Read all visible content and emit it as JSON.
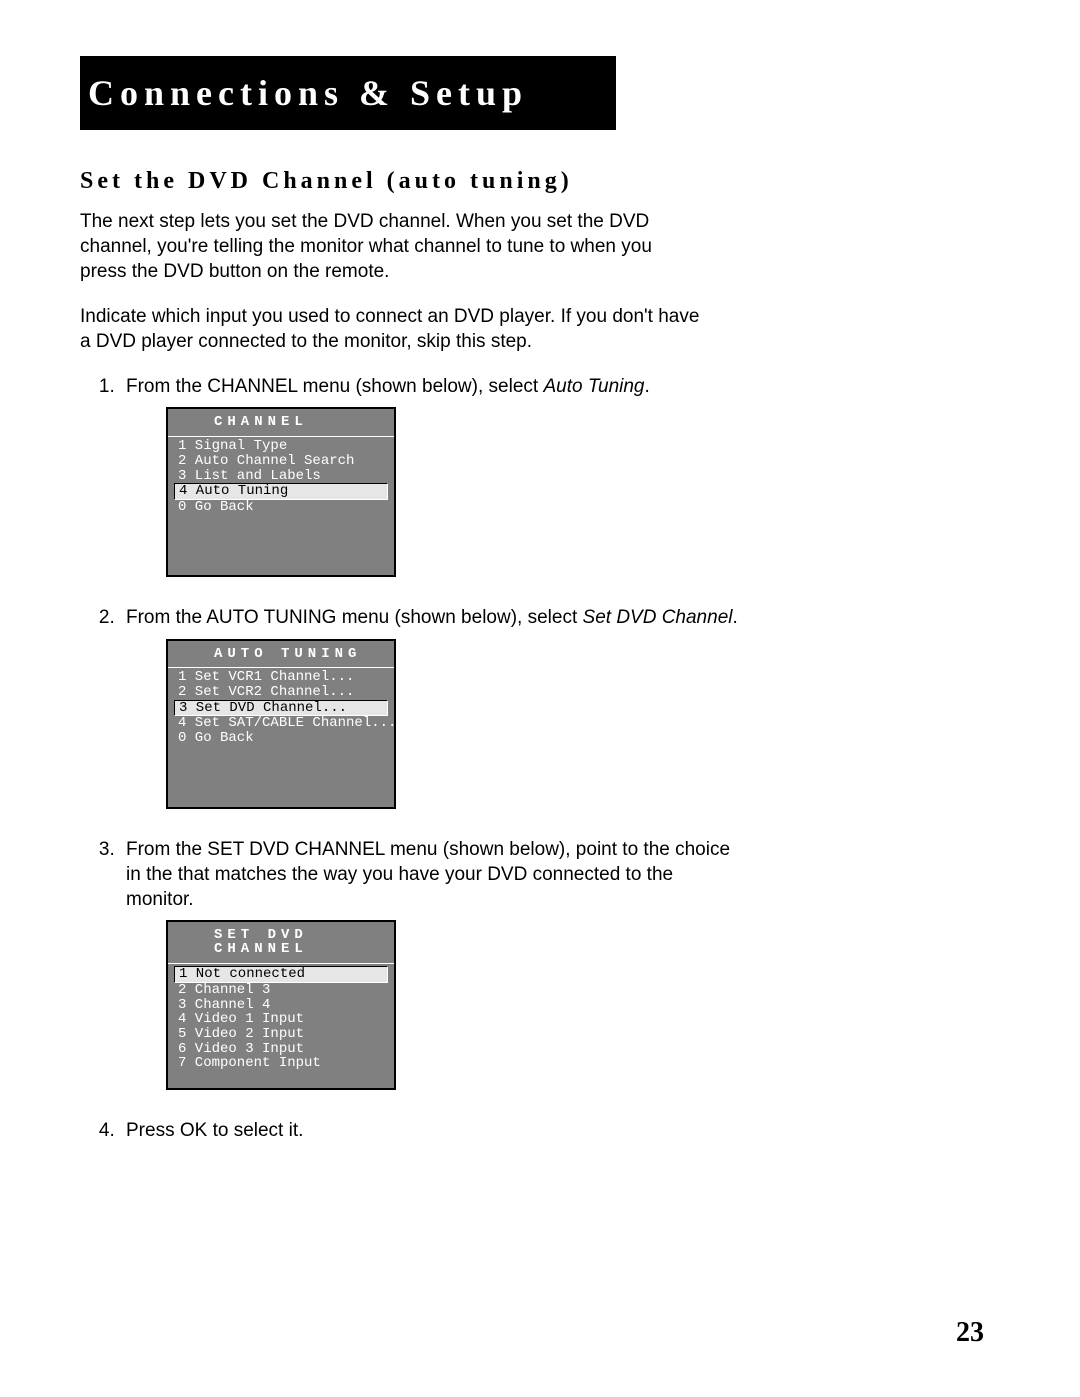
{
  "banner": "Connections & Setup",
  "section_title": "Set the DVD Channel (auto tuning)",
  "intro_p1": "The next step lets you set the DVD channel. When you set the DVD channel, you're telling the monitor what channel to tune to when you press the DVD button on the remote.",
  "intro_p2": "Indicate which input you used to connect an DVD player. If you don't have a DVD player connected to the monitor, skip this step.",
  "step1_pre": "From the CHANNEL menu (shown below), select ",
  "step1_em": "Auto Tuning",
  "step1_post": ".",
  "step2_pre": "From the AUTO TUNING menu (shown below), select ",
  "step2_em": "Set DVD Channel",
  "step2_post": ".",
  "step3": "From the SET DVD CHANNEL menu (shown below), point to the choice in the that matches the way you have your DVD connected to the monitor.",
  "step4": "Press OK to select it.",
  "menu1": {
    "title": "CHANNEL",
    "items": [
      {
        "n": "1",
        "label": "Signal Type",
        "selected": false
      },
      {
        "n": "2",
        "label": "Auto Channel Search",
        "selected": false
      },
      {
        "n": "3",
        "label": "List and Labels",
        "selected": false
      },
      {
        "n": "4",
        "label": "Auto Tuning",
        "selected": true
      },
      {
        "n": "0",
        "label": "Go Back",
        "selected": false
      }
    ]
  },
  "menu2": {
    "title": "AUTO TUNING",
    "items": [
      {
        "n": "1",
        "label": "Set VCR1 Channel...",
        "selected": false
      },
      {
        "n": "2",
        "label": "Set VCR2 Channel...",
        "selected": false
      },
      {
        "n": "3",
        "label": "Set DVD Channel...",
        "selected": true
      },
      {
        "n": "4",
        "label": "Set SAT/CABLE Channel...",
        "selected": false
      },
      {
        "n": "0",
        "label": "Go Back",
        "selected": false
      }
    ]
  },
  "menu3": {
    "title": "SET DVD CHANNEL",
    "items": [
      {
        "n": "1",
        "label": "Not connected",
        "selected": true
      },
      {
        "n": "2",
        "label": "Channel 3",
        "selected": false
      },
      {
        "n": "3",
        "label": "Channel 4",
        "selected": false
      },
      {
        "n": "4",
        "label": "Video 1 Input",
        "selected": false
      },
      {
        "n": "5",
        "label": "Video 2 Input",
        "selected": false
      },
      {
        "n": "6",
        "label": "Video 3 Input",
        "selected": false
      },
      {
        "n": "7",
        "label": "Component Input",
        "selected": false
      }
    ]
  },
  "page_number": "23"
}
